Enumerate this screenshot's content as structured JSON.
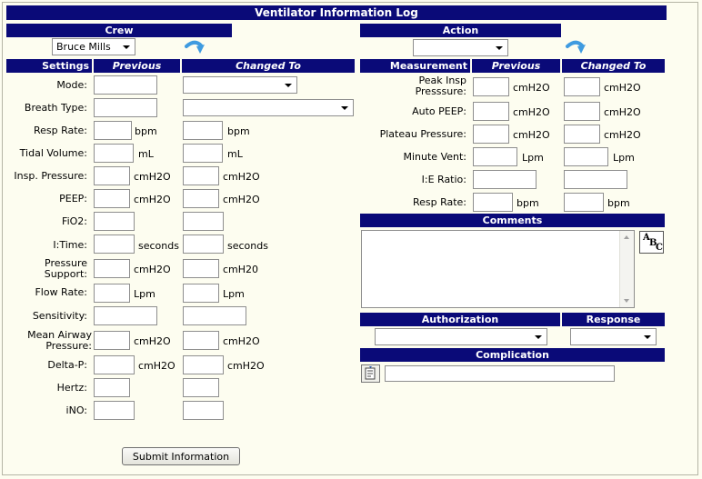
{
  "title": "Ventilator Information Log",
  "crew": {
    "header": "Crew",
    "selected": "Bruce Mills"
  },
  "action": {
    "header": "Action",
    "selected": ""
  },
  "settings": {
    "header": "Settings",
    "previous_header": "Previous",
    "changed_header": "Changed To",
    "rows": [
      {
        "label": "Mode:",
        "unit": ""
      },
      {
        "label": "Breath Type:",
        "unit": ""
      },
      {
        "label": "Resp Rate:",
        "unit": "bpm"
      },
      {
        "label": "Tidal Volume:",
        "unit": "mL"
      },
      {
        "label": "Insp. Pressure:",
        "unit": "cmH2O"
      },
      {
        "label": "PEEP:",
        "unit": "cmH2O"
      },
      {
        "label": "FiO2:",
        "unit": ""
      },
      {
        "label": "I:Time:",
        "unit": "seconds"
      },
      {
        "label_line1": "Pressure",
        "label_line2": "Support:",
        "unit": "cmH2O",
        "unit_changed": "cmH20"
      },
      {
        "label": "Flow Rate:",
        "unit": "Lpm"
      },
      {
        "label": "Sensitivity:",
        "unit": ""
      },
      {
        "label_line1": "Mean Airway",
        "label_line2": "Pressure:",
        "unit": "cmH2O"
      },
      {
        "label": "Delta-P:",
        "unit": "cmH2O"
      },
      {
        "label": "Hertz:",
        "unit": ""
      },
      {
        "label": "iNO:",
        "unit": ""
      }
    ]
  },
  "measurement": {
    "header": "Measurement",
    "previous_header": "Previous",
    "changed_header": "Changed To",
    "rows": [
      {
        "label_line1": "Peak Insp",
        "label_line2": "Presssure:",
        "unit": "cmH2O"
      },
      {
        "label": "Auto PEEP:",
        "unit": "cmH2O"
      },
      {
        "label": "Plateau Pressure:",
        "unit": "cmH2O"
      },
      {
        "label": "Minute Vent:",
        "unit": "Lpm"
      },
      {
        "label": "I:E Ratio:",
        "unit": ""
      },
      {
        "label": "Resp Rate:",
        "unit": "bpm"
      }
    ]
  },
  "comments": {
    "header": "Comments",
    "value": "",
    "spell_icon": "spell-check-icon"
  },
  "authorization": {
    "header": "Authorization",
    "selected": ""
  },
  "response": {
    "header": "Response",
    "selected": ""
  },
  "complication": {
    "header": "Complication",
    "value": "",
    "lookup_icon": "lookup-icon"
  },
  "submit_label": "Submit Information",
  "colors": {
    "header_bg": "#0a0a78",
    "page_bg": "#fdfdf0",
    "refresh_icon": "#3f9be0"
  }
}
